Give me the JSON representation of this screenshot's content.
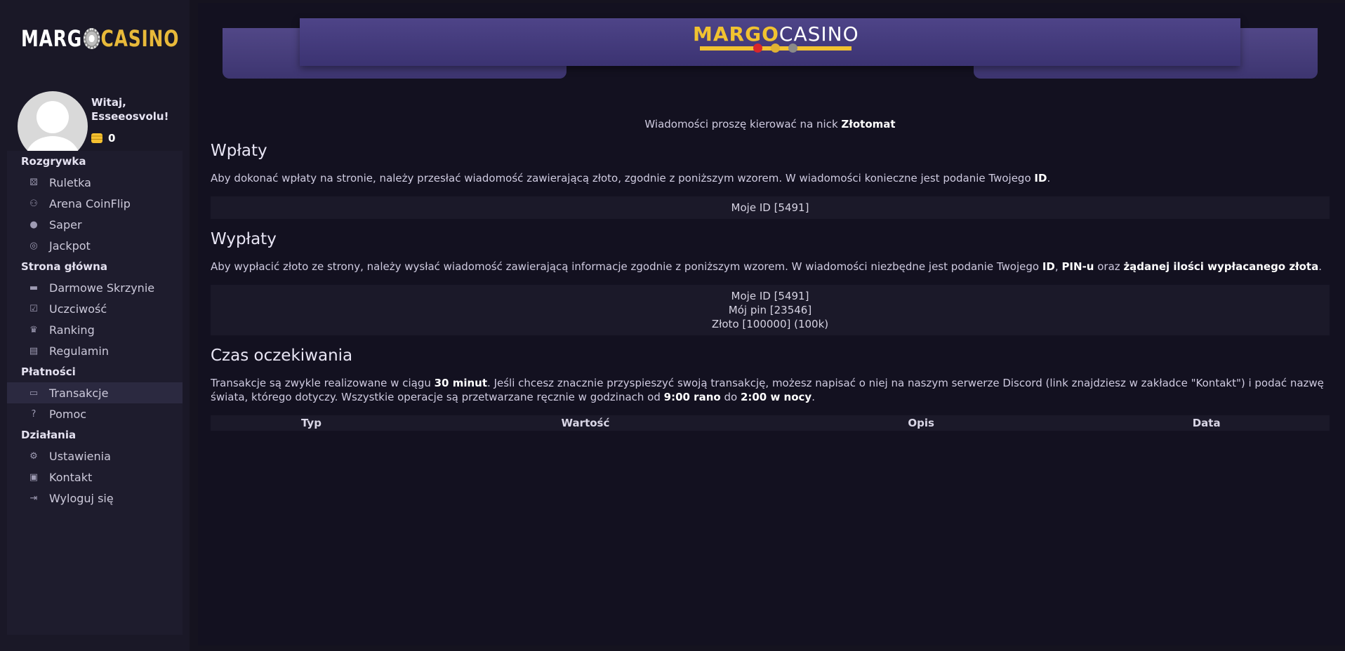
{
  "sidebar": {
    "logo": {
      "left": "MARG",
      "right": "CASINO"
    },
    "user": {
      "greeting": "Witaj, Esseeosvolu!",
      "coins": "0"
    },
    "sections": [
      {
        "title": "Rozgrywka",
        "items": [
          {
            "label": "Ruletka",
            "icon": "dice-icon"
          },
          {
            "label": "Arena CoinFlip",
            "icon": "people-icon"
          },
          {
            "label": "Saper",
            "icon": "bomb-icon"
          },
          {
            "label": "Jackpot",
            "icon": "target-icon"
          }
        ]
      },
      {
        "title": "Strona główna",
        "items": [
          {
            "label": "Darmowe Skrzynie",
            "icon": "briefcase-icon"
          },
          {
            "label": "Uczciwość",
            "icon": "clipboard-check-icon"
          },
          {
            "label": "Ranking",
            "icon": "trophy-icon"
          },
          {
            "label": "Regulamin",
            "icon": "book-icon"
          }
        ]
      },
      {
        "title": "Płatności",
        "items": [
          {
            "label": "Transakcje",
            "icon": "card-icon",
            "active": true
          },
          {
            "label": "Pomoc",
            "icon": "question-icon"
          }
        ]
      },
      {
        "title": "Działania",
        "items": [
          {
            "label": "Ustawienia",
            "icon": "user-cog-icon"
          },
          {
            "label": "Kontakt",
            "icon": "contact-book-icon"
          },
          {
            "label": "Wyloguj się",
            "icon": "logout-icon"
          }
        ]
      }
    ]
  },
  "banner": {
    "left": "MARGO",
    "right": "CASINO"
  },
  "main": {
    "notice_prefix": "Wiadomości proszę kierować na nick ",
    "notice_nick": "Złotomat",
    "deposits": {
      "heading": "Wpłaty",
      "desc_text": "Aby dokonać wpłaty na stronie, należy przesłać wiadomość zawierającą złoto, zgodnie z poniższym wzorem. W wiadomości konieczne jest podanie Twojego ",
      "desc_bold": "ID",
      "desc_end": ".",
      "template": "Moje ID [5491]"
    },
    "withdrawals": {
      "heading": "Wypłaty",
      "desc_text": "Aby wypłacić złoto ze strony, należy wysłać wiadomość zawierającą informacje zgodnie z poniższym wzorem. W wiadomości niezbędne jest podanie Twojego ",
      "desc_b1": "ID",
      "desc_sep1": ", ",
      "desc_b2": "PIN-u",
      "desc_sep2": " oraz ",
      "desc_b3": "żądanej ilości wypłacanego złota",
      "desc_end": ".",
      "template_lines": [
        "Moje ID [5491]",
        "Mój pin [23546]",
        "Złoto [100000] (100k)"
      ]
    },
    "waiting": {
      "heading": "Czas oczekiwania",
      "t1": "Transakcje są zwykle realizowane w ciągu ",
      "b1": "30 minut",
      "t2": ". Jeśli chcesz znacznie przyspieszyć swoją transakcję, możesz napisać o niej na naszym serwerze Discord (link znajdziesz w zakładce \"Kontakt\") i podać nazwę świata, którego dotyczy. Wszystkie operacje są przetwarzane ręcznie w godzinach od ",
      "b2": "9:00 rano",
      "t3": " do ",
      "b3": "2:00 w nocy",
      "t4": "."
    },
    "table": {
      "headers": [
        "Typ",
        "Wartość",
        "Opis",
        "Data"
      ]
    }
  }
}
